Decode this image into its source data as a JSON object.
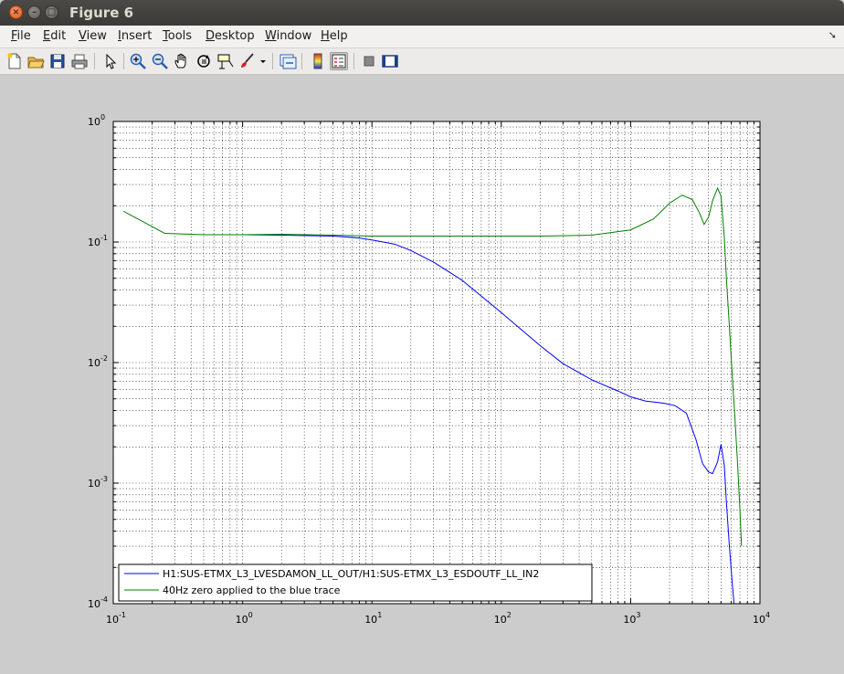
{
  "window": {
    "title": "Figure 6"
  },
  "menu": {
    "items": [
      {
        "first": "F",
        "rest": "ile"
      },
      {
        "first": "E",
        "rest": "dit"
      },
      {
        "first": "V",
        "rest": "iew"
      },
      {
        "first": "I",
        "rest": "nsert"
      },
      {
        "first": "T",
        "rest": "ools"
      },
      {
        "first": "D",
        "rest": "esktop"
      },
      {
        "first": "W",
        "rest": "indow"
      },
      {
        "first": "H",
        "rest": "elp"
      }
    ],
    "overflow_icon": "arrow-icon"
  },
  "toolbar": {
    "buttons": [
      "new-figure-icon",
      "open-file-icon",
      "save-figure-icon",
      "print-figure-icon",
      "edit-plot-icon",
      "zoom-in-icon",
      "zoom-out-icon",
      "pan-icon",
      "rotate-3d-icon",
      "data-cursor-icon",
      "brush-icon",
      "link-plot-icon",
      "insert-colorbar-icon",
      "insert-legend-icon",
      "hide-plot-tools-icon",
      "show-plot-tools-icon"
    ]
  },
  "chart_data": {
    "type": "line",
    "xscale": "log",
    "yscale": "log",
    "xlim": [
      0.1,
      10000
    ],
    "ylim": [
      0.0001,
      1
    ],
    "grid": true,
    "legend_position": "bottom-left",
    "xticks": [
      {
        "base": "10",
        "exp": "-1"
      },
      {
        "base": "10",
        "exp": "0"
      },
      {
        "base": "10",
        "exp": "1"
      },
      {
        "base": "10",
        "exp": "2"
      },
      {
        "base": "10",
        "exp": "3"
      },
      {
        "base": "10",
        "exp": "4"
      }
    ],
    "yticks": [
      {
        "base": "10",
        "exp": "-4"
      },
      {
        "base": "10",
        "exp": "-3"
      },
      {
        "base": "10",
        "exp": "-2"
      },
      {
        "base": "10",
        "exp": "-1"
      },
      {
        "base": "10",
        "exp": "0"
      }
    ],
    "series": [
      {
        "name": "H1:SUS-ETMX_L3_LVESDAMON_LL_OUT/H1:SUS-ETMX_L3_ESDOUTF_LL_IN2",
        "color": "#0000ff",
        "x": [
          1,
          2,
          5,
          8,
          10,
          15,
          20,
          30,
          50,
          100,
          200,
          300,
          500,
          800,
          1000,
          1300,
          1800,
          2200,
          2700,
          3200,
          3600,
          4000,
          4300,
          4700,
          5000,
          5300,
          5500,
          5800,
          6100,
          6300,
          6500
        ],
        "y": [
          0.115,
          0.114,
          0.112,
          0.108,
          0.104,
          0.096,
          0.085,
          0.068,
          0.048,
          0.026,
          0.0138,
          0.0098,
          0.0072,
          0.0058,
          0.0052,
          0.0048,
          0.0046,
          0.0044,
          0.0038,
          0.0023,
          0.00145,
          0.00124,
          0.0012,
          0.0015,
          0.0021,
          0.0014,
          0.0007,
          0.0003,
          0.00015,
          0.0001,
          8e-05
        ]
      },
      {
        "name": "40Hz zero applied to the blue trace",
        "color": "#007f00",
        "x": [
          0.12,
          0.25,
          0.5,
          1,
          2,
          5,
          10,
          20,
          50,
          100,
          200,
          500,
          1000,
          1500,
          2000,
          2500,
          3000,
          3400,
          3700,
          4000,
          4300,
          4700,
          5000,
          5300,
          5500,
          5800,
          6100,
          6400,
          6700,
          7000,
          7200
        ],
        "y": [
          0.18,
          0.118,
          0.115,
          0.115,
          0.116,
          0.114,
          0.112,
          0.112,
          0.112,
          0.112,
          0.112,
          0.114,
          0.126,
          0.155,
          0.21,
          0.245,
          0.225,
          0.175,
          0.14,
          0.16,
          0.22,
          0.28,
          0.24,
          0.11,
          0.05,
          0.02,
          0.008,
          0.0035,
          0.0015,
          0.0006,
          0.0003
        ]
      }
    ]
  }
}
